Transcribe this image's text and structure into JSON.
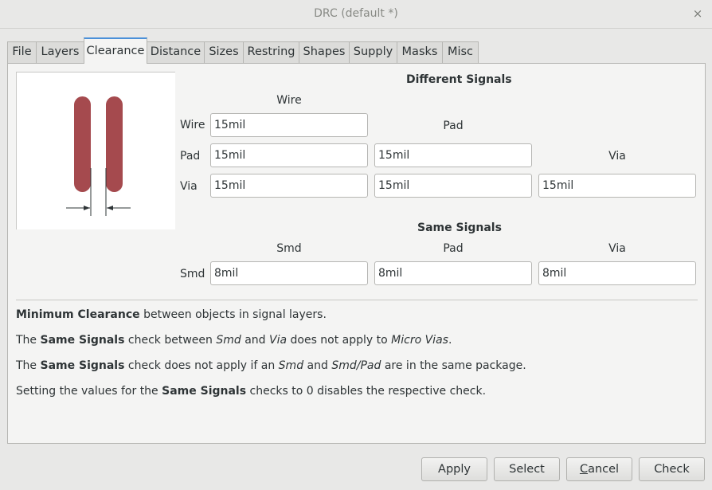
{
  "window": {
    "title": "DRC (default *)",
    "close_glyph": "×"
  },
  "tabs": [
    {
      "label": "File"
    },
    {
      "label": "Layers"
    },
    {
      "label": "Clearance"
    },
    {
      "label": "Distance"
    },
    {
      "label": "Sizes"
    },
    {
      "label": "Restring"
    },
    {
      "label": "Shapes"
    },
    {
      "label": "Supply"
    },
    {
      "label": "Masks"
    },
    {
      "label": "Misc"
    }
  ],
  "active_tab": "Clearance",
  "different_signals": {
    "title": "Different Signals",
    "col_wire": "Wire",
    "col_pad": "Pad",
    "col_via": "Via",
    "row_wire": "Wire",
    "row_pad": "Pad",
    "row_via": "Via",
    "wire_wire": "15mil",
    "pad_wire": "15mil",
    "pad_pad": "15mil",
    "via_wire": "15mil",
    "via_pad": "15mil",
    "via_via": "15mil"
  },
  "same_signals": {
    "title": "Same Signals",
    "col_smd": "Smd",
    "col_pad": "Pad",
    "col_via": "Via",
    "row_smd": "Smd",
    "smd_smd": "8mil",
    "smd_pad": "8mil",
    "smd_via": "8mil"
  },
  "notes": {
    "n1_bold": "Minimum Clearance",
    "n1_rest": " between objects in signal layers.",
    "n2_a": "The ",
    "n2_bold": "Same Signals",
    "n2_b": " check between ",
    "n2_i1": "Smd",
    "n2_c": " and ",
    "n2_i2": "Via",
    "n2_d": " does not apply to ",
    "n2_i3": "Micro Vias",
    "n2_e": ".",
    "n3_a": "The ",
    "n3_bold": "Same Signals",
    "n3_b": " check does not apply if an ",
    "n3_i1": "Smd",
    "n3_c": " and ",
    "n3_i2": "Smd/Pad",
    "n3_d": " are in the same package.",
    "n4_a": "Setting the values for the ",
    "n4_bold": "Same Signals",
    "n4_b": " checks to 0 disables the respective check."
  },
  "buttons": {
    "apply": "Apply",
    "select": "Select",
    "cancel_pre": "",
    "cancel_mnemonic": "C",
    "cancel_post": "ancel",
    "check": "Check"
  },
  "colors": {
    "trace": "#a54a4e",
    "tab_accent": "#4a90d9",
    "background": "#e8e8e7"
  }
}
